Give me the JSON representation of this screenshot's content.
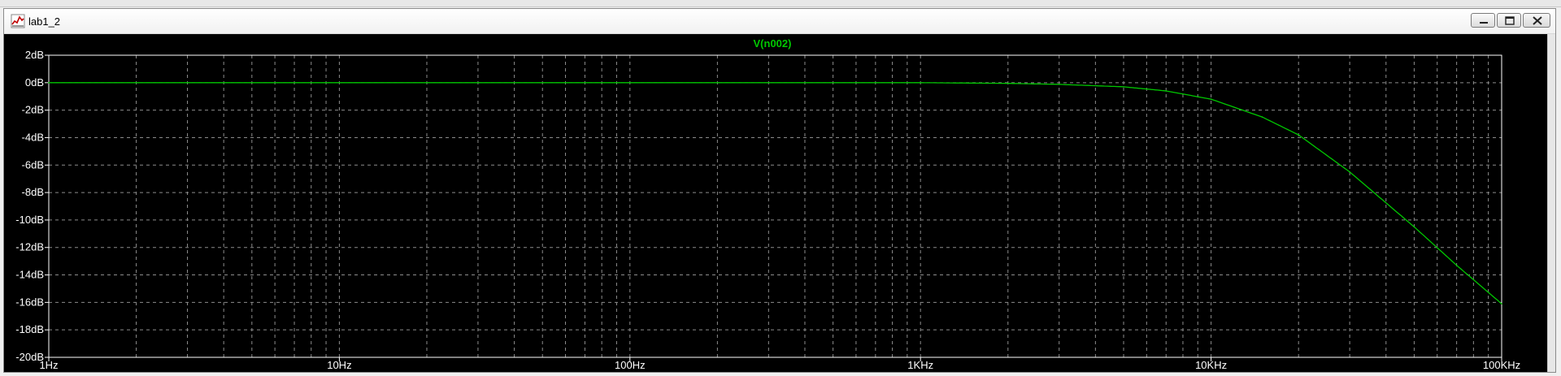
{
  "window": {
    "title": "lab1_2",
    "title_icon": "waveform-icon",
    "buttons": [
      "minimize-icon",
      "maximize-icon",
      "close-icon"
    ]
  },
  "colors": {
    "background": "#000000",
    "grid": "#8c8c8c",
    "frame": "#ffffff",
    "trace": "#00c800",
    "label": "#ffffff"
  },
  "chart_data": {
    "type": "line",
    "title": "V(n002)",
    "xscale": "log",
    "xlim": [
      1,
      100000
    ],
    "ylim": [
      -20,
      2
    ],
    "x_ticks": [
      "1Hz",
      "10Hz",
      "100Hz",
      "1KHz",
      "10KHz",
      "100KHz"
    ],
    "y_ticks": [
      "2dB",
      "0dB",
      "-2dB",
      "-4dB",
      "-6dB",
      "-8dB",
      "-10dB",
      "-12dB",
      "-14dB",
      "-16dB",
      "-18dB",
      "-20dB"
    ],
    "grid": true,
    "series": [
      {
        "name": "V(n002)",
        "x": [
          1,
          10,
          100,
          1000,
          2000,
          3000,
          5000,
          7000,
          10000,
          15000,
          20000,
          30000,
          50000,
          70000,
          100000
        ],
        "y": [
          0,
          0,
          0,
          0,
          -0.05,
          -0.12,
          -0.3,
          -0.6,
          -1.2,
          -2.5,
          -3.8,
          -6.5,
          -10.5,
          -13.3,
          -16.1
        ]
      }
    ]
  }
}
